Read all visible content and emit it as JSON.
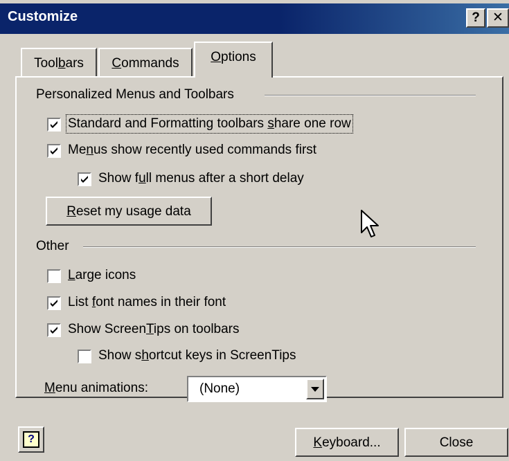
{
  "window": {
    "title": "Customize",
    "help_glyph": "?",
    "close_glyph": "✕"
  },
  "tabs": [
    {
      "label": "Toolbars",
      "pre": "Tool",
      "acc": "b",
      "post": "ars"
    },
    {
      "label": "Commands",
      "pre": "",
      "acc": "C",
      "post": "ommands"
    },
    {
      "label": "Options",
      "pre": "",
      "acc": "O",
      "post": "ptions"
    }
  ],
  "options": {
    "personalized": {
      "group_label": "Personalized Menus and Toolbars",
      "share_row": {
        "pre": "Standard and Formatting toolbars ",
        "acc": "s",
        "post": "hare one row",
        "checked": true
      },
      "recent_first": {
        "pre": "Me",
        "acc": "n",
        "post": "us show recently used commands first",
        "checked": true
      },
      "full_menus": {
        "pre": "Show f",
        "acc": "u",
        "post": "ll menus after a short delay",
        "checked": true
      },
      "reset_button": {
        "pre": "",
        "acc": "R",
        "post": "eset my usage data"
      }
    },
    "other": {
      "group_label": "Other",
      "large_icons": {
        "pre": "",
        "acc": "L",
        "post": "arge icons",
        "checked": false
      },
      "font_names": {
        "pre": "List ",
        "acc": "f",
        "post": "ont names in their font",
        "checked": true
      },
      "screentips": {
        "pre": "Show Screen",
        "acc": "T",
        "post": "ips on toolbars",
        "checked": true
      },
      "shortcut_keys": {
        "pre": "Show s",
        "acc": "h",
        "post": "ortcut keys in ScreenTips",
        "checked": false
      },
      "menu_animations": {
        "pre": "",
        "acc": "M",
        "post": "enu animations:",
        "value": "(None)"
      }
    }
  },
  "footer": {
    "help_glyph": "?",
    "keyboard": {
      "pre": "",
      "acc": "K",
      "post": "eyboard..."
    },
    "close": {
      "label": "Close"
    }
  }
}
